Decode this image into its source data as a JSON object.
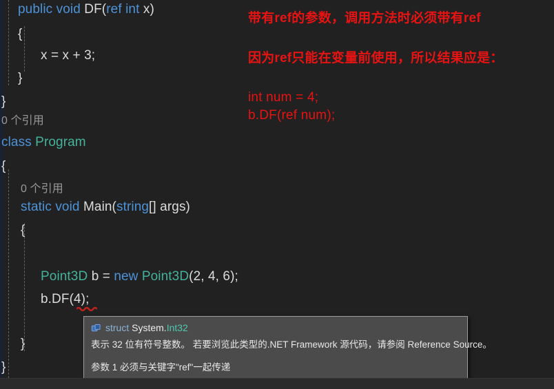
{
  "editor": {
    "background": "#212121",
    "keyword_color": "#4d93d9",
    "type_color": "#45b39b",
    "plain_color": "#dcdcdc",
    "codelens_color": "#9a9a9a",
    "annotation_color": "#e81313",
    "lines": [
      {
        "indent": "    ",
        "segments": [
          {
            "text": "public void ",
            "cls": "kw"
          },
          {
            "text": "DF(",
            "cls": "pln"
          },
          {
            "text": "ref int ",
            "cls": "kw"
          },
          {
            "text": "x)",
            "cls": "pln"
          }
        ]
      },
      {
        "indent": "    ",
        "segments": [
          {
            "text": "{",
            "cls": "pln"
          }
        ]
      },
      {
        "indent": "        ",
        "segments": [
          {
            "text": "x = x + 3;",
            "cls": "pln"
          }
        ]
      },
      {
        "indent": "    ",
        "segments": [
          {
            "text": "}",
            "cls": "pln"
          }
        ]
      },
      {
        "indent": "",
        "segments": [
          {
            "text": "}",
            "cls": "pln"
          }
        ]
      }
    ],
    "codelens_1": "0 个引用",
    "class_line": {
      "keyword": "class ",
      "name": "Program"
    },
    "brace_open_class": "{",
    "codelens_2": "0 个引用",
    "main_line": {
      "keyword1": "static void ",
      "name": "Main(",
      "keyword2": "string",
      "rest": "[] args)"
    },
    "brace_open_main": "{",
    "point_line": {
      "type1": "Point3D ",
      "var": "b ",
      "eq": "= ",
      "kw_new": "new ",
      "type2": "Point3D",
      "args": "(2, 4, 6);"
    },
    "call_line": "b.DF(4);",
    "brace_close_main": "}",
    "brace_close_class": "}"
  },
  "annotations": [
    {
      "text": "带有ref的参数，调用方法时必须带有ref"
    },
    {
      "text": "因为ref只能在变量前使用，所以结果应是："
    },
    {
      "text": "int num = 4;"
    },
    {
      "text": "b.DF(ref num);"
    }
  ],
  "tooltip": {
    "icon": "struct-icon",
    "keyword": "struct ",
    "namespace": "System.",
    "type": "Int32",
    "description": "表示 32 位有符号整数。 若要浏览此类型的.NET Framework 源代码，请参阅 Reference Source。",
    "error": "参数 1 必须与关键字\"ref\"一起传递"
  }
}
